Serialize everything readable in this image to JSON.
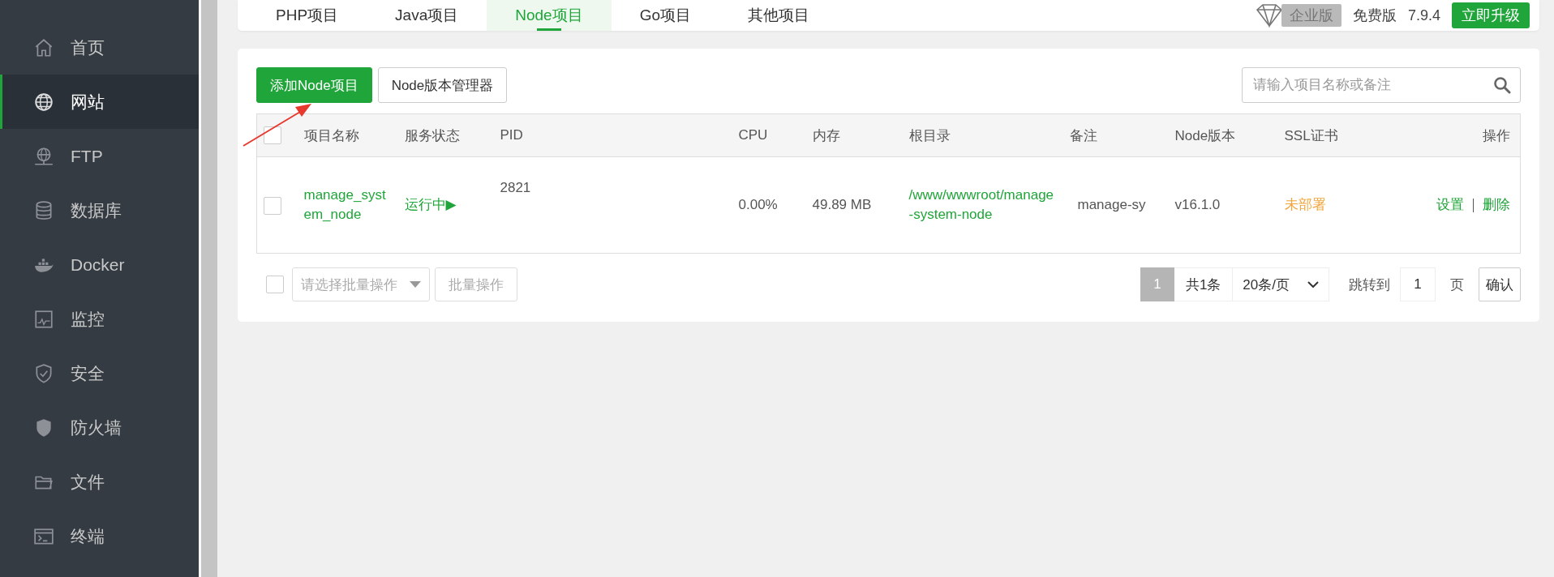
{
  "sidebar": {
    "items": [
      {
        "label": "首页",
        "selected": false
      },
      {
        "label": "网站",
        "selected": true
      },
      {
        "label": "FTP",
        "selected": false
      },
      {
        "label": "数据库",
        "selected": false
      },
      {
        "label": "Docker",
        "selected": false
      },
      {
        "label": "监控",
        "selected": false
      },
      {
        "label": "安全",
        "selected": false
      },
      {
        "label": "防火墙",
        "selected": false
      },
      {
        "label": "文件",
        "selected": false
      },
      {
        "label": "终端",
        "selected": false
      }
    ]
  },
  "tabs": [
    {
      "label": "PHP项目",
      "selected": false
    },
    {
      "label": "Java项目",
      "selected": false
    },
    {
      "label": "Node项目",
      "selected": true
    },
    {
      "label": "Go项目",
      "selected": false
    },
    {
      "label": "其他项目",
      "selected": false
    }
  ],
  "edition": {
    "badge": "企业版",
    "label": "免费版",
    "version": "7.9.4",
    "upgrade": "立即升级"
  },
  "toolbar": {
    "buttons": [
      "添加Node项目",
      "Node版本管理器"
    ],
    "search": {
      "placeholder": "请输入项目名称或备注"
    }
  },
  "table": {
    "select_all": {
      "checked": false
    },
    "columns": [
      "项目名称",
      "服务状态",
      "PID",
      "CPU",
      "内存",
      "根目录",
      "备注",
      "Node版本",
      "SSL证书",
      "操作"
    ],
    "rows": [
      {
        "checked": false,
        "name": "manage_system_node",
        "status": "运行中▶",
        "pid": "2821",
        "cpu": "0.00%",
        "memory": "49.89 MB",
        "root": "/www/wwwroot/manage-system-node",
        "note": "manage-sy",
        "node_version": "v16.1.0",
        "ssl": "未部署",
        "actions": [
          "设置",
          "删除"
        ]
      }
    ]
  },
  "footer": {
    "select_all": {
      "checked": false
    },
    "batch_select": {
      "placeholder": "请选择批量操作"
    },
    "batch_button": "批量操作",
    "pages": [
      {
        "label": "1",
        "selected": true
      }
    ],
    "total": "共1条",
    "page_size": "20条/页",
    "jump_label": "跳转到",
    "jump_value": "1",
    "page_unit": "页",
    "confirm": "确认"
  }
}
